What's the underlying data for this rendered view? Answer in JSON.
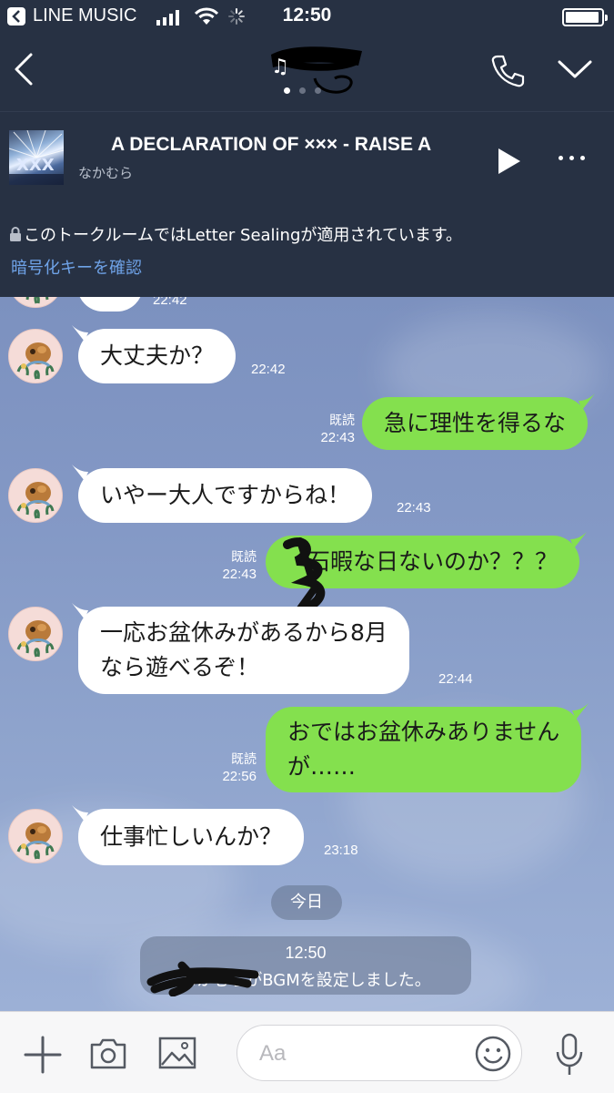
{
  "status_bar": {
    "carrier": "LINE MUSIC",
    "time": "12:50"
  },
  "header": {
    "dots": 3,
    "active_dot": 0
  },
  "music": {
    "song": "A DECLARATION OF ××× - RAISE A",
    "artist": "なかむら"
  },
  "notice": {
    "sealing_text": "このトークルームではLetter Sealingが適用されています。",
    "link": "暗号化キーを確認"
  },
  "messages": [
    {
      "dir": "in",
      "text": "",
      "time": "22:42"
    },
    {
      "dir": "in",
      "text": "大丈夫か？",
      "time": "22:42"
    },
    {
      "dir": "out",
      "text": "急に理性を得るな",
      "read": "既読",
      "time": "22:43"
    },
    {
      "dir": "in",
      "text": "いやー大人ですからね！",
      "time": "22:43"
    },
    {
      "dir": "out",
      "text": "石暇な日ないのか？？？",
      "read": "既読",
      "time": "22:43"
    },
    {
      "dir": "in",
      "text": "一応お盆休みがあるから8月\nなら遊べるぞ！",
      "time": "22:44"
    },
    {
      "dir": "out",
      "text": "おではお盆休みありません\nが……",
      "read": "既読",
      "time": "22:56"
    },
    {
      "dir": "in",
      "text": "仕事忙しいんか？",
      "time": "23:18"
    }
  ],
  "date_separator": "今日",
  "system_message": {
    "time": "12:50",
    "text": "なかむらがBGMを設定しました。"
  },
  "input": {
    "placeholder": "Aa"
  },
  "colors": {
    "header_bg": "#273143",
    "bubble_out": "#84e04e",
    "bubble_in": "#ffffff",
    "link": "#6fa3e8"
  },
  "icons": [
    "back-icon",
    "call-icon",
    "chevron-down-icon",
    "play-icon",
    "more-icon",
    "lock-icon",
    "plus-icon",
    "camera-icon",
    "image-icon",
    "emoji-icon",
    "mic-icon",
    "wifi-icon",
    "battery-icon"
  ]
}
